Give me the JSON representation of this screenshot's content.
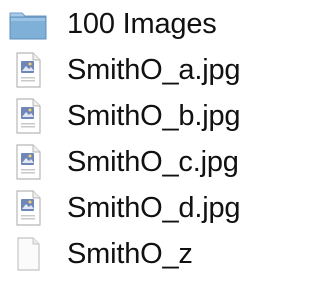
{
  "items": [
    {
      "label": "100 Images",
      "icon": "folder-icon",
      "kind": "folder"
    },
    {
      "label": "SmithO_a.jpg",
      "icon": "jpeg-file-icon",
      "kind": "image"
    },
    {
      "label": "SmithO_b.jpg",
      "icon": "jpeg-file-icon",
      "kind": "image"
    },
    {
      "label": "SmithO_c.jpg",
      "icon": "jpeg-file-icon",
      "kind": "image"
    },
    {
      "label": "SmithO_d.jpg",
      "icon": "jpeg-file-icon",
      "kind": "image"
    },
    {
      "label": "SmithO_z",
      "icon": "blank-file-icon",
      "kind": "document"
    }
  ],
  "colors": {
    "folder_body": "#7fb0d8",
    "folder_tab": "#a9cbe8",
    "doc_border": "#b7b7b7",
    "image_badge": "#6f86b8",
    "text": "#111111"
  }
}
